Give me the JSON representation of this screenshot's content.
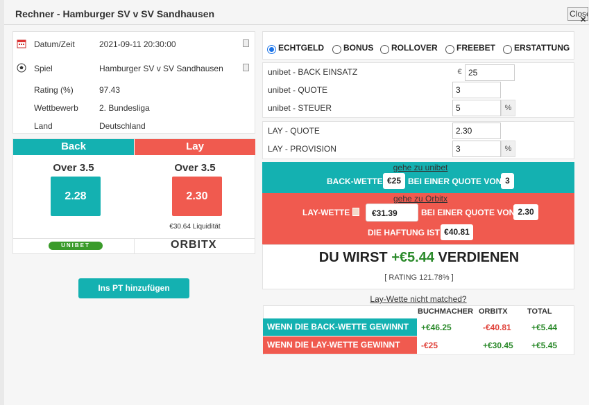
{
  "modal": {
    "title": "Rechner - Hamburger SV v SV Sandhausen",
    "close_label": "Close"
  },
  "info": {
    "datum_label": "Datum/Zeit",
    "datum_value": "2021-09-11 20:30:00",
    "spiel_label": "Spiel",
    "spiel_value": "Hamburger SV v SV Sandhausen",
    "rating_label": "Rating (%)",
    "rating_value": "97.43",
    "wettbewerb_label": "Wettbewerb",
    "wettbewerb_value": "2. Bundesliga",
    "land_label": "Land",
    "land_value": "Deutschland"
  },
  "back": {
    "header": "Back",
    "selection": "Over 3.5",
    "odds": "2.28",
    "bookmaker_logo": "UNIBET"
  },
  "lay": {
    "header": "Lay",
    "selection": "Over 3.5",
    "odds": "2.30",
    "liquidity": "€30.64 Liquidität",
    "exchange_logo": "ORBITX"
  },
  "add_button": "Ins PT hinzufügen",
  "modes": {
    "selected": "ECHTGELD",
    "options": [
      "ECHTGELD",
      "BONUS",
      "ROLLOVER",
      "FREEBET",
      "ERSTATTUNG"
    ]
  },
  "fields": {
    "back_stake_label": "unibet - BACK EINSATZ",
    "back_stake_currency": "€",
    "back_stake_value": "25",
    "back_odds_label": "unibet - QUOTE",
    "back_odds_value": "3",
    "back_tax_label": "unibet - STEUER",
    "back_tax_value": "5",
    "back_tax_unit": "%",
    "lay_odds_label": "LAY - QUOTE",
    "lay_odds_value": "2.30",
    "lay_commission_label": "LAY - PROVISION",
    "lay_commission_value": "3",
    "lay_commission_unit": "%"
  },
  "result": {
    "back_link": "gehe zu unibet",
    "back_wette_label": "BACK-WETTE",
    "back_wette_value": "€25",
    "at_odds_label": "BEI EINER QUOTE VON",
    "back_wette_odds": "3",
    "lay_link": "gehe zu Orbitx",
    "lay_wette_label": "LAY-WETTE",
    "lay_wette_value": "€31.39",
    "lay_wette_odds": "2.30",
    "liability_label": "DIE HAFTUNG IST",
    "liability_value": "€40.81",
    "profit_prefix": "DU WIRST",
    "profit_value": "+€5.44",
    "profit_suffix": "VERDIENEN",
    "rating": "[ RATING 121.78% ]",
    "not_matched_link": "Lay-Wette nicht matched?"
  },
  "outcome_table": {
    "columns": [
      "BUCHMACHER",
      "ORBITX",
      "TOTAL"
    ],
    "rows": [
      {
        "label": "WENN DIE BACK-WETTE GEWINNT",
        "values": [
          "+€46.25",
          "-€40.81",
          "+€5.44"
        ]
      },
      {
        "label": "WENN DIE LAY-WETTE GEWINNT",
        "values": [
          "-€25",
          "+€30.45",
          "+€5.45"
        ]
      }
    ]
  },
  "colors": {
    "teal": "#14b1b1",
    "red": "#f05a4f",
    "positive": "#2b8a2b",
    "negative": "#e0423a"
  }
}
